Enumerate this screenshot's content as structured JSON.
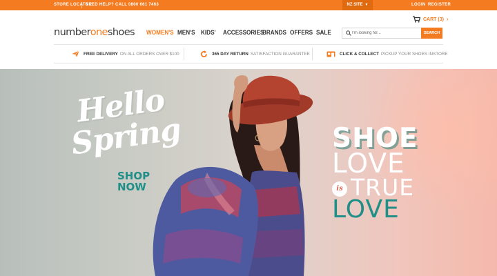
{
  "topbar": {
    "store_locator": "STORE LOCATOR",
    "help": "NEED HELP? CALL 0800 661 7463",
    "region": "NZ SITE",
    "login": "LOGIN",
    "register": "REGISTER"
  },
  "cart": {
    "label": "CART (3)"
  },
  "brand": {
    "name_part1": "number",
    "name_part2": "one",
    "name_part3": "shoes"
  },
  "nav": {
    "items": [
      "WOMEN'S",
      "MEN'S",
      "KIDS'",
      "ACCESSORIES",
      "BRANDS",
      "OFFERS",
      "SALE"
    ],
    "active": "WOMEN'S"
  },
  "search": {
    "placeholder": "I'm looking for...",
    "value": "",
    "button": "SEARCH"
  },
  "usps": [
    {
      "bold": "FREE DELIVERY",
      "light": "ON ALL ORDERS OVER $100",
      "icon": "paper-plane-icon"
    },
    {
      "bold": "365 DAY RETURN",
      "light": "SATISFACTION GUARANTEE",
      "icon": "return-arrow-icon"
    },
    {
      "bold": "CLICK & COLLECT",
      "light": "PICKUP YOUR SHOES INSTORE",
      "icon": "store-icon"
    }
  ],
  "hero": {
    "hello": "Hello",
    "spring": "Spring",
    "shop": "SHOP",
    "now": "NOW",
    "shoe": "SHOE",
    "love": "LOVE",
    "is": "is",
    "true": "TRUE",
    "love2": "LOVE"
  },
  "colors": {
    "accent": "#f47b20",
    "teal": "#1f8f88",
    "text": "#333333"
  }
}
